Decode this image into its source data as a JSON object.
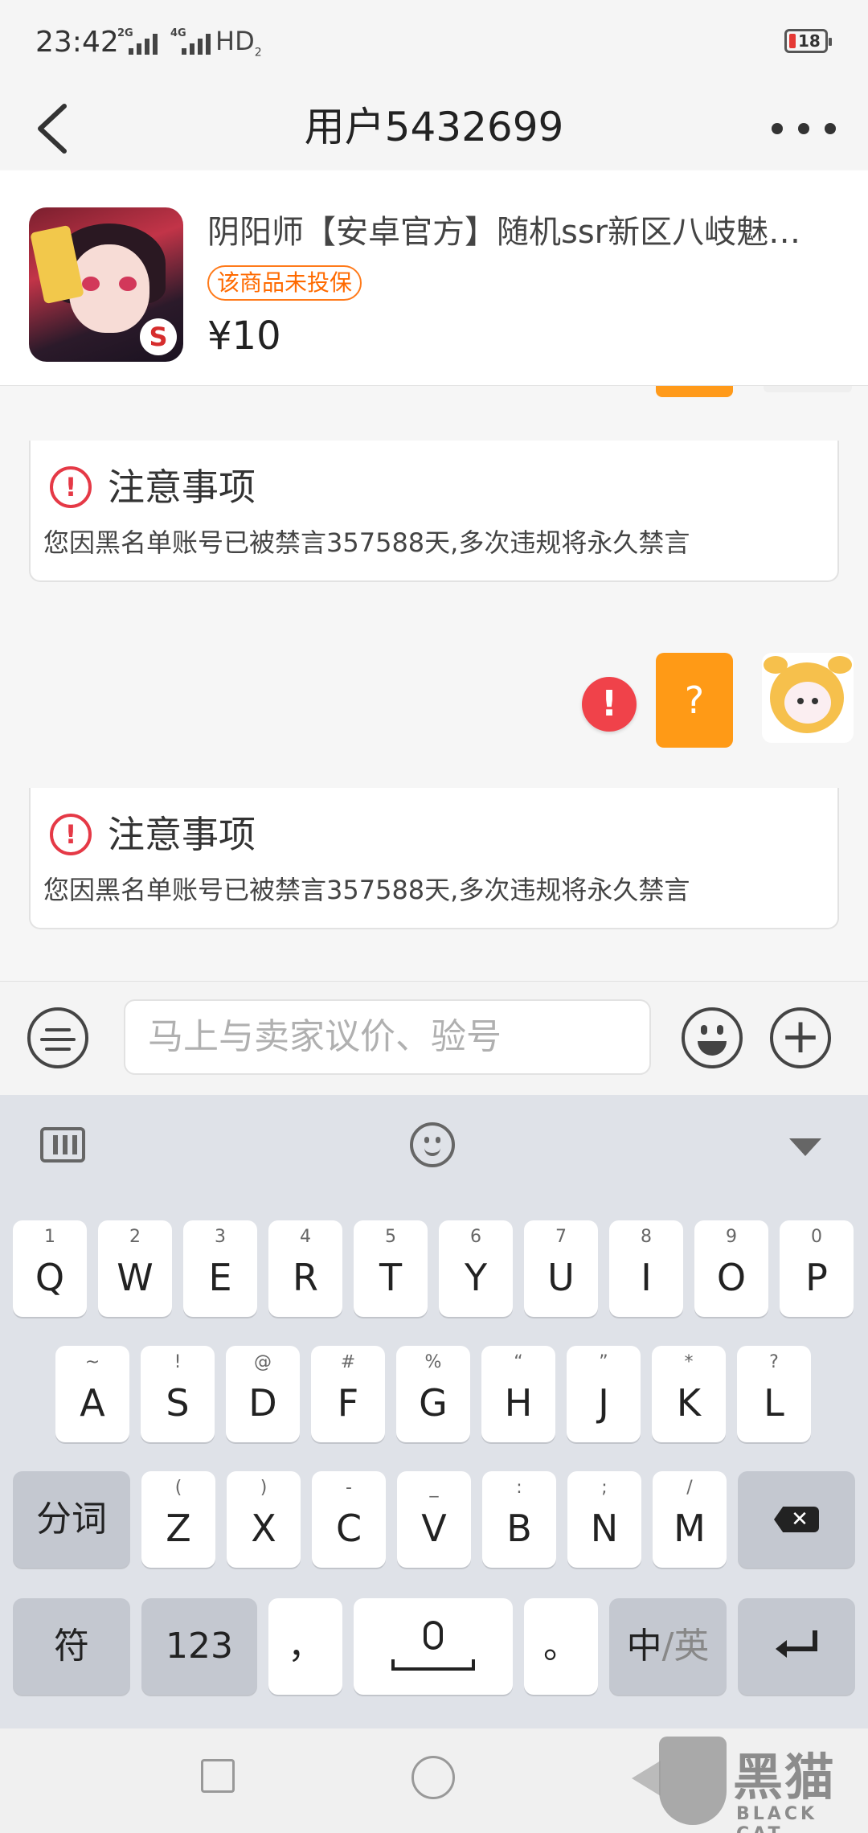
{
  "status_bar": {
    "time": "23:42",
    "signal1_label": "2G",
    "signal2_label": "4G",
    "hd_label": "HD",
    "hd_sub": "2",
    "battery": "18"
  },
  "header": {
    "title": "用户5432699"
  },
  "product": {
    "title": "阴阳师【安卓官方】随机ssr新区八岐魅…",
    "badge": "该商品未投保",
    "price": "¥10"
  },
  "notices": [
    {
      "title": "注意事项",
      "text": "您因黑名单账号已被禁言357588天,多次违规将永久禁言"
    },
    {
      "title": "注意事项",
      "text": "您因黑名单账号已被禁言357588天,多次违规将永久禁言"
    }
  ],
  "message": {
    "bubble_text": "?",
    "error_mark": "!"
  },
  "input": {
    "placeholder": "马上与卖家议价、验号"
  },
  "keyboard": {
    "row1": [
      {
        "k": "Q",
        "s": "1"
      },
      {
        "k": "W",
        "s": "2"
      },
      {
        "k": "E",
        "s": "3"
      },
      {
        "k": "R",
        "s": "4"
      },
      {
        "k": "T",
        "s": "5"
      },
      {
        "k": "Y",
        "s": "6"
      },
      {
        "k": "U",
        "s": "7"
      },
      {
        "k": "I",
        "s": "8"
      },
      {
        "k": "O",
        "s": "9"
      },
      {
        "k": "P",
        "s": "0"
      }
    ],
    "row2": [
      {
        "k": "A",
        "s": "~"
      },
      {
        "k": "S",
        "s": "!"
      },
      {
        "k": "D",
        "s": "@"
      },
      {
        "k": "F",
        "s": "#"
      },
      {
        "k": "G",
        "s": "%"
      },
      {
        "k": "H",
        "s": "“"
      },
      {
        "k": "J",
        "s": "”"
      },
      {
        "k": "K",
        "s": "*"
      },
      {
        "k": "L",
        "s": "?"
      }
    ],
    "row3": [
      {
        "k": "Z",
        "s": "("
      },
      {
        "k": "X",
        "s": ")"
      },
      {
        "k": "C",
        "s": "-"
      },
      {
        "k": "V",
        "s": "_"
      },
      {
        "k": "B",
        "s": ":"
      },
      {
        "k": "N",
        "s": ";"
      },
      {
        "k": "M",
        "s": "/"
      }
    ],
    "fenci": "分词",
    "symbols": "符",
    "numbers": "123",
    "comma": "，",
    "period": "。",
    "lang_zh": "中",
    "lang_sep": "/",
    "lang_en": "英",
    "delete_mark": "✕"
  },
  "watermark": {
    "cn": "黑猫",
    "en": "BLACK CAT"
  },
  "colors": {
    "accent_orange": "#ff9a16",
    "error_red": "#f0424a",
    "badge_orange": "#ff6a00"
  }
}
